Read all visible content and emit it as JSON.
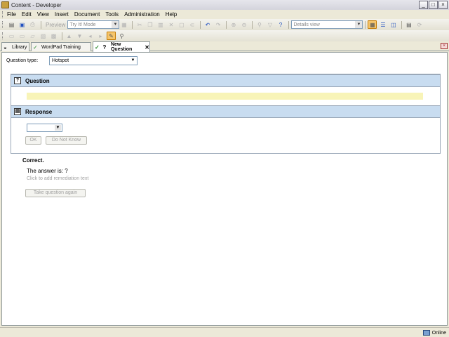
{
  "window": {
    "title": "Content - Developer"
  },
  "menu": [
    "File",
    "Edit",
    "View",
    "Insert",
    "Document",
    "Tools",
    "Administration",
    "Help"
  ],
  "toolbar": {
    "preview_label": "Preview",
    "mode_select": "Try It! Mode",
    "view_select": "Details view"
  },
  "tabs": [
    {
      "label": "Library",
      "active": false
    },
    {
      "label": "WordPad Training",
      "active": false
    },
    {
      "label": "New Question",
      "active": true
    }
  ],
  "question_type": {
    "label": "Question type:",
    "value": "Hotspot"
  },
  "sections": {
    "question": "Question",
    "response": "Response"
  },
  "buttons": {
    "ok": "OK",
    "do_not_know": "Do Not Know",
    "take_again": "Take question again"
  },
  "feedback": {
    "result": "Correct.",
    "answer": "The answer is: ?",
    "remediation_hint": "Click to add remediation text"
  },
  "status": {
    "connection": "Online"
  },
  "colors": {
    "section_header": "#c8dcf0",
    "question_field": "#f8f4b8",
    "active_tool": "#f5c56c"
  }
}
